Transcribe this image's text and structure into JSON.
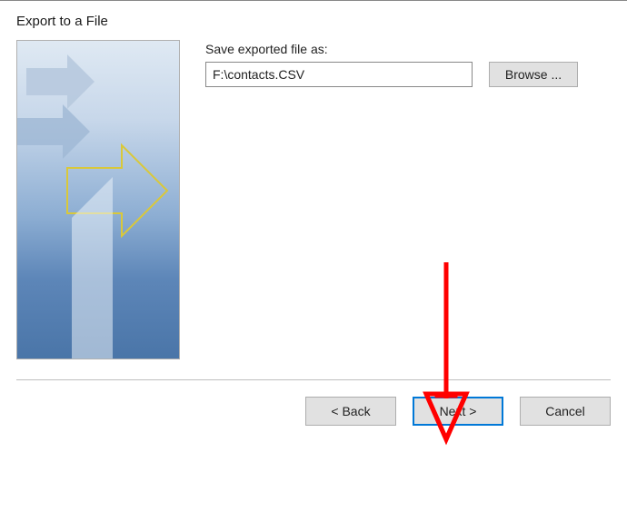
{
  "dialog": {
    "title": "Export to a File"
  },
  "form": {
    "label": "Save exported file as:",
    "filepath": "F:\\contacts.CSV",
    "browse_label": "Browse ..."
  },
  "buttons": {
    "back": "< Back",
    "next": "Next >",
    "cancel": "Cancel"
  },
  "annotation": {
    "arrow_color": "#ff0000"
  }
}
